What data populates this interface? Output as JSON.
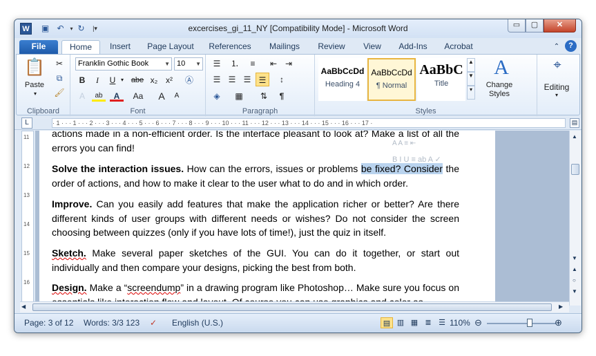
{
  "window": {
    "title": "excercises_gi_11_NY [Compatibility Mode]  -  Microsoft Word"
  },
  "quick_access": {
    "app_icon": "W",
    "icons": [
      "save-icon",
      "undo-icon",
      "redo-icon",
      "customize-icon"
    ]
  },
  "window_controls": {
    "minimize": "▭",
    "maximize": "▢",
    "close": "✕"
  },
  "tabs": [
    "File",
    "Home",
    "Insert",
    "Page Layout",
    "References",
    "Mailings",
    "Review",
    "View",
    "Add-Ins",
    "Acrobat"
  ],
  "ribbon": {
    "clipboard": {
      "paste": "Paste",
      "label": "Clipboard"
    },
    "font": {
      "family": "Franklin Gothic Book",
      "size": "10",
      "label": "Font",
      "bold": "B",
      "italic": "I",
      "underline": "U",
      "strike": "abe",
      "sub": "x₂",
      "sup": "x²",
      "grow": "A",
      "shrink": "A",
      "case": "Aa"
    },
    "paragraph": {
      "label": "Paragraph",
      "pilcrow": "¶"
    },
    "styles": {
      "label": "Styles",
      "items": [
        {
          "sample": "AaBbCcDd",
          "name": "Heading 4"
        },
        {
          "sample": "AaBbCcDd",
          "name": "¶ Normal"
        },
        {
          "sample": "AaBbC",
          "name": "Title"
        }
      ],
      "change_label": "Change Styles"
    },
    "editing": {
      "label": "Editing"
    }
  },
  "document": {
    "p0_tail": "actions made in a non-efficient order. Is the interface pleasant to look at? Make a list of all the errors you can find!",
    "p1_head": "Solve the interaction issues.",
    "p1_pre": " How can the errors, issues or problems ",
    "p1_sel": "be fixed? Consider",
    "p1_post": " the order of actions, and how to make it clear to the user what to do and in which order.",
    "p2_head": "Improve.",
    "p2_body": " Can you easily add features that make the application richer or better? Are there different kinds of user groups with different needs or wishes? Do not consider the screen choosing between quizzes (only if you have lots of time!), just the quiz in itself.",
    "p3_head": "Sketch.",
    "p3_body": " Make several paper sketches of the GUI. You can do it together, or start out individually and then compare your designs, picking the best from both.",
    "p4_head": "Design.",
    "p4_pre": " Make a “",
    "p4_squig": "screendump",
    "p4_post": "” in a drawing program like Photoshop… Make sure you focus on essentials like interaction flow and layout. Of course you can use graphics and color as"
  },
  "ruler": {
    "numbers": "· 1 · · · 1 · · · 2 · · · 3 · · · 4 · · · 5 · · · 6 · · · 7 · · · 8 · · · 9 · · · 10 · · · 11 · · · 12 · · · 13 · · · 14 · · · 15 · · · 16 · · · 17 ·",
    "vnumbers": [
      "11",
      "12",
      "13",
      "14",
      "15",
      "16"
    ]
  },
  "status": {
    "page": "Page: 3 of 12",
    "words": "Words: 3/3 123",
    "language": "English (U.S.)",
    "zoom": "110%",
    "zoom_level": 0.62
  }
}
